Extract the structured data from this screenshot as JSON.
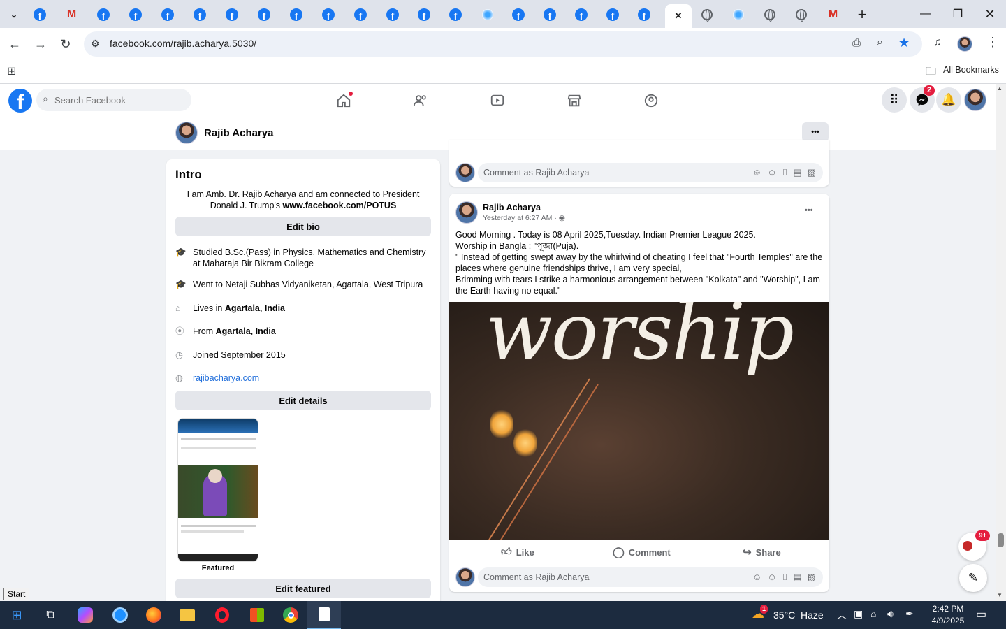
{
  "browser": {
    "active_tab_close": "✕",
    "new_tab": "+",
    "url": "facebook.com/rajib.acharya.5030/",
    "bookmarks_label": "All Bookmarks"
  },
  "fb": {
    "search_placeholder": "Search Facebook",
    "messenger_badge": "2"
  },
  "profile": {
    "name": "Rajib Acharya",
    "more": "•••"
  },
  "intro": {
    "title": "Intro",
    "bio_text": "I am Amb. Dr. Rajib Acharya and am connected to President Donald J. Trump's",
    "bio_link": "www.facebook.com/POTUS",
    "edit_bio": "Edit bio",
    "details": [
      {
        "icon": "education-icon",
        "text": "Studied B.Sc.(Pass) in Physics, Mathematics and Chemistry at Maharaja Bir Bikram College"
      },
      {
        "icon": "education-icon",
        "text": "Went to Netaji Subhas Vidyaniketan, Agartala, West Tripura"
      },
      {
        "icon": "home-icon",
        "prefix": "Lives in ",
        "bold": "Agartala, India"
      },
      {
        "icon": "location-icon",
        "prefix": "From ",
        "bold": "Agartala, India"
      },
      {
        "icon": "clock-icon",
        "text": "Joined September 2015"
      },
      {
        "icon": "globe-icon",
        "link": "rajibacharya.com"
      }
    ],
    "edit_details": "Edit details",
    "featured_label": "Featured",
    "edit_featured": "Edit featured"
  },
  "top_comment": {
    "placeholder": "Comment as Rajib Acharya"
  },
  "post": {
    "author": "Rajib Acharya",
    "time": "Yesterday at 6:27 AM · ",
    "menu": "•••",
    "lines": [
      "Good Morning . Today is 08 April 2025,Tuesday. Indian Premier League 2025.",
      "Worship in Bangla : \"পূজা(Puja).",
      "\" Instead of getting swept away by the whirlwind of cheating I feel that \"Fourth Temples\" are the places where genuine friendships thrive, I am very special,",
      "Brimming with tears I strike a harmonious arrangement between \"Kolkata\" and \"Worship\", I am the Earth having no equal.\""
    ],
    "image_word": "worship",
    "like": "Like",
    "comment": "Comment",
    "share": "Share",
    "comment_placeholder": "Comment as Rajib Acharya"
  },
  "floating_badge": "9+",
  "start_tooltip": "Start",
  "taskbar": {
    "temperature": "35°C",
    "weather": "Haze",
    "weather_badge": "1",
    "time": "2:42 PM",
    "date": "4/9/2025"
  }
}
